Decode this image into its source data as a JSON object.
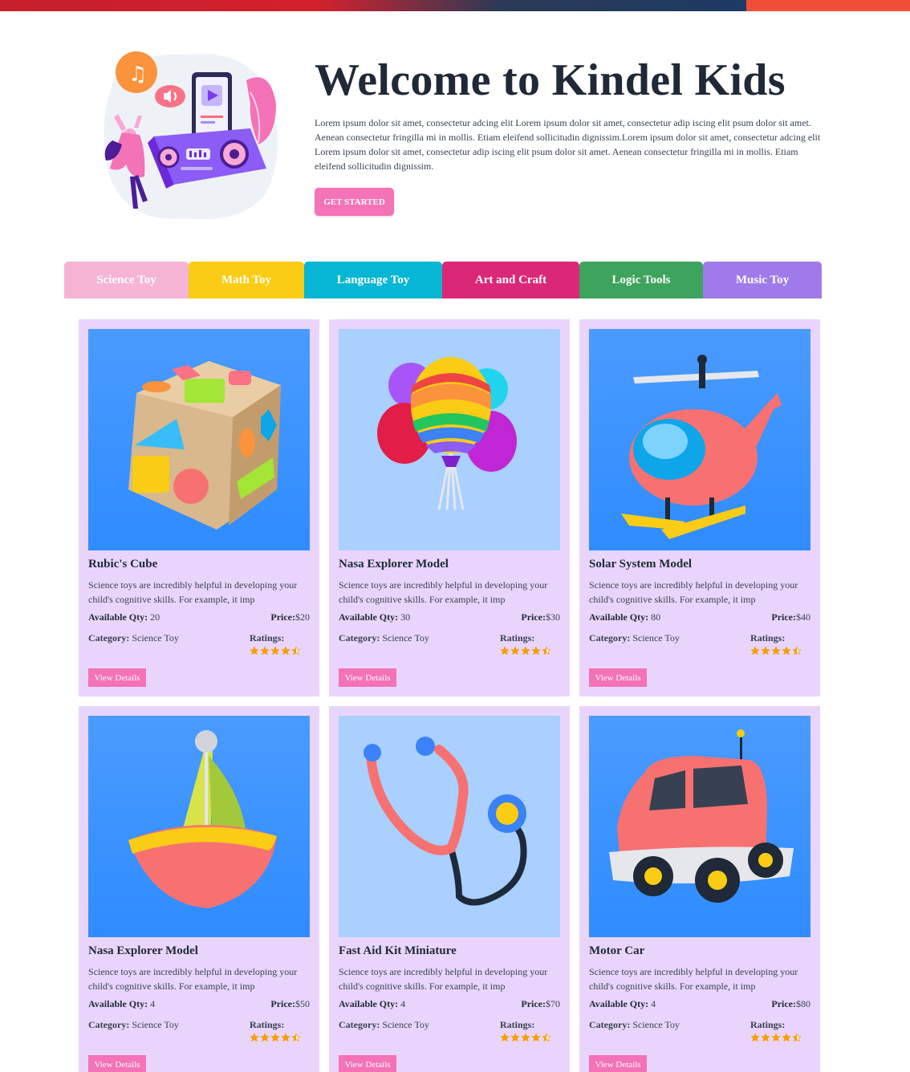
{
  "hero": {
    "title": "Welcome to Kindel Kids",
    "description": "Lorem ipsum dolor sit amet, consectetur adcing elit Lorem ipsum dolor sit amet, consectetur adip iscing elit psum dolor sit amet. Aenean consectetur fringilla mi in mollis. Etiam eleifend sollicitudin dignissim.Lorem ipsum dolor sit amet, consectetur adcing elit Lorem ipsum dolor sit amet, consectetur adip iscing elit psum dolor sit amet. Aenean consectetur fringilla mi in mollis. Etiam eleifend sollicitudin dignissim.",
    "cta_label": "GET STARTED"
  },
  "tabs": [
    {
      "label": "Science Toy",
      "color": "#f5b4d4"
    },
    {
      "label": "Math Toy",
      "color": "#facc15"
    },
    {
      "label": "Language Toy",
      "color": "#06b6d4"
    },
    {
      "label": "Art and Craft",
      "color": "#db2777"
    },
    {
      "label": "Logic Tools",
      "color": "#3da35d"
    },
    {
      "label": "Music Toy",
      "color": "#a07ae9"
    }
  ],
  "labels": {
    "qty": "Available Qty:",
    "price": "Price:",
    "category": "Category:",
    "ratings": "Ratings:",
    "view": "View Details"
  },
  "colors": {
    "card_bg": "#e9d5fb",
    "accent_pink": "#f472b6",
    "star": "#f59e0b"
  },
  "products": [
    {
      "name": "Rubic's Cube",
      "desc": "Science toys are incredibly helpful in developing your child's cognitive skills. For example, it imp",
      "qty": "20",
      "price": "$20",
      "category": "Science Toy",
      "rating": 4.5,
      "image_icon": "shape-sorter-cube"
    },
    {
      "name": "Nasa Explorer Model",
      "desc": "Science toys are incredibly helpful in developing your child's cognitive skills. For example, it imp",
      "qty": "30",
      "price": "$30",
      "category": "Science Toy",
      "rating": 4.5,
      "image_icon": "balloons"
    },
    {
      "name": "Solar System Model",
      "desc": "Science toys are incredibly helpful in developing your child's cognitive skills. For example, it imp",
      "qty": "80",
      "price": "$40",
      "category": "Science Toy",
      "rating": 4.5,
      "image_icon": "helicopter"
    },
    {
      "name": "Nasa Explorer Model",
      "desc": "Science toys are incredibly helpful in developing your child's cognitive skills. For example, it imp",
      "qty": "4",
      "price": "$50",
      "category": "Science Toy",
      "rating": 4.5,
      "image_icon": "sailboat"
    },
    {
      "name": "Fast Aid Kit Miniature",
      "desc": "Science toys are incredibly helpful in developing your child's cognitive skills. For example, it imp",
      "qty": "4",
      "price": "$70",
      "category": "Science Toy",
      "rating": 4.5,
      "image_icon": "stethoscope"
    },
    {
      "name": "Motor Car",
      "desc": "Science toys are incredibly helpful in developing your child's cognitive skills. For example, it imp",
      "qty": "4",
      "price": "$80",
      "category": "Science Toy",
      "rating": 4.5,
      "image_icon": "toy-car"
    }
  ]
}
